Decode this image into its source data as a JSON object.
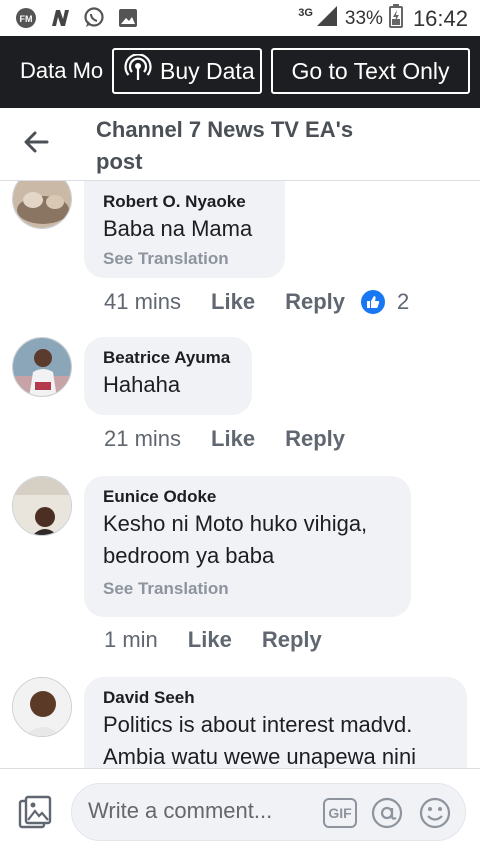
{
  "status_bar": {
    "network": "3G",
    "battery_percent": "33%",
    "time": "16:42",
    "icons": [
      "fm-radio-icon",
      "n-app-icon",
      "whatsapp-icon",
      "gallery-icon",
      "signal-icon",
      "battery-icon"
    ]
  },
  "data_banner": {
    "mode_label": "Data Mo",
    "buy_data_label": "Buy Data",
    "text_only_label": "Go to Text Only"
  },
  "header": {
    "title": "Channel 7 News TV EA's post"
  },
  "comments": [
    {
      "author": "Robert O. Nyaoke",
      "text": "Baba na Mama",
      "see_translation": "See Translation",
      "time": "41 mins",
      "like_label": "Like",
      "reply_label": "Reply",
      "reaction_count": "2"
    },
    {
      "author": "Beatrice Ayuma",
      "text": "Hahaha",
      "time": "21 mins",
      "like_label": "Like",
      "reply_label": "Reply"
    },
    {
      "author": "Eunice Odoke",
      "text": "Kesho ni Moto huko vihiga, bedroom ya baba",
      "see_translation": "See Translation",
      "time": "1 min",
      "like_label": "Like",
      "reply_label": "Reply"
    },
    {
      "author": "David Seeh",
      "text": "Politics is about interest madvd. Ambia watu wewe unapewa nini"
    }
  ],
  "composer": {
    "placeholder": "Write a comment...",
    "gif_label": "GIF"
  },
  "colors": {
    "banner_bg": "#1c1e21",
    "bubble_bg": "#f0f2f5",
    "like_blue": "#1877f2",
    "meta_gray": "#606770"
  }
}
